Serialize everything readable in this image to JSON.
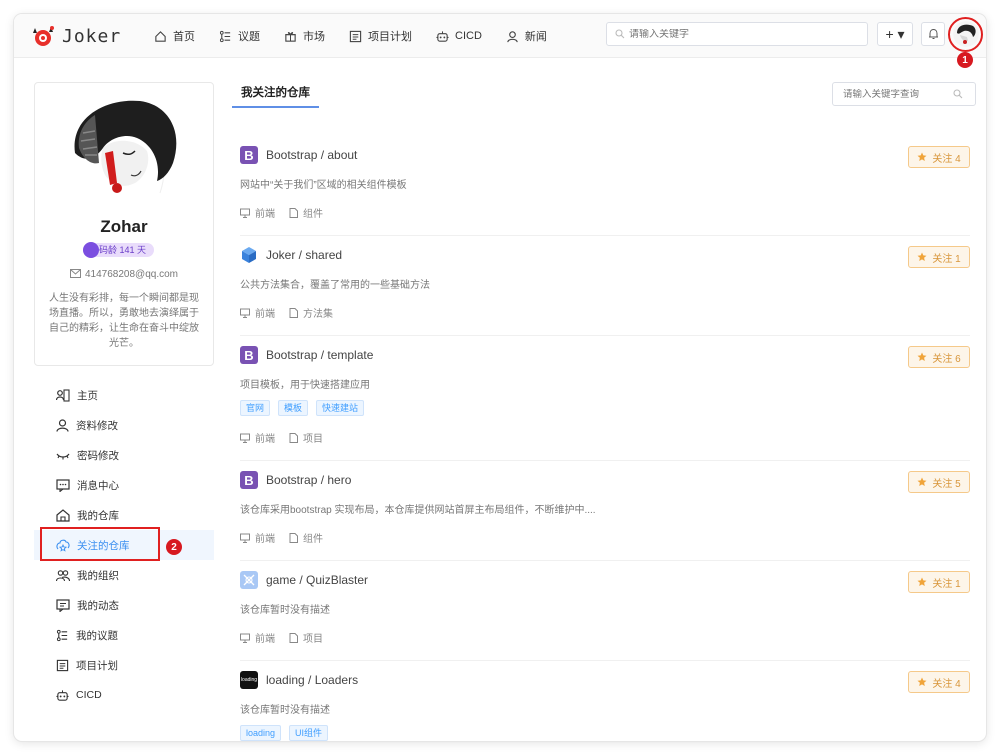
{
  "header": {
    "app_name": "Joker",
    "nav": [
      {
        "label": "首页",
        "icon": "home-icon"
      },
      {
        "label": "议题",
        "icon": "issue-icon"
      },
      {
        "label": "市场",
        "icon": "gift-icon"
      },
      {
        "label": "项目计划",
        "icon": "plan-icon"
      },
      {
        "label": "CICD",
        "icon": "robot-icon"
      },
      {
        "label": "新闻",
        "icon": "user-news-icon"
      }
    ],
    "search_placeholder": "请输入关键字",
    "plus_label": "+ ▾"
  },
  "annotations": {
    "marker1": "1",
    "marker2": "2"
  },
  "profile": {
    "name": "Zohar",
    "age_badge": "码龄 141 天",
    "email": "414768208@qq.com",
    "bio": "人生没有彩排，每一个瞬间都是现场直播。所以，勇敢地去演绎属于自己的精彩，让生命在奋斗中绽放光芒。"
  },
  "menu": [
    {
      "label": "主页",
      "icon": "home-card-icon",
      "active": false
    },
    {
      "label": "资料修改",
      "icon": "user-icon",
      "active": false
    },
    {
      "label": "密码修改",
      "icon": "eye-closed-icon",
      "active": false
    },
    {
      "label": "消息中心",
      "icon": "message-icon",
      "active": false
    },
    {
      "label": "我的仓库",
      "icon": "repo-house-icon",
      "active": false
    },
    {
      "label": "关注的仓库",
      "icon": "star-repo-icon",
      "active": true
    },
    {
      "label": "我的组织",
      "icon": "group-icon",
      "active": false
    },
    {
      "label": "我的动态",
      "icon": "activity-icon",
      "active": false
    },
    {
      "label": "我的议题",
      "icon": "issue-icon",
      "active": false
    },
    {
      "label": "项目计划",
      "icon": "plan-icon",
      "active": false
    },
    {
      "label": "CICD",
      "icon": "robot-icon",
      "active": false
    }
  ],
  "main": {
    "tab": "我关注的仓库",
    "search_placeholder": "请输入关键字查询",
    "repos": [
      {
        "title": "Bootstrap / about",
        "icon": "bootstrap",
        "desc": "网站中“关于我们”区域的相关组件模板",
        "tags": [],
        "category": "前端",
        "type": "组件",
        "star": "关注 4"
      },
      {
        "title": "Joker / shared",
        "icon": "cube",
        "desc": "公共方法集合，覆盖了常用的一些基础方法",
        "tags": [],
        "category": "前端",
        "type": "方法集",
        "star": "关注 1"
      },
      {
        "title": "Bootstrap / template",
        "icon": "bootstrap",
        "desc": "项目模板，用于快速搭建应用",
        "tags": [
          "官网",
          "模板",
          "快速建站"
        ],
        "category": "前端",
        "type": "项目",
        "star": "关注 6"
      },
      {
        "title": "Bootstrap / hero",
        "icon": "bootstrap",
        "desc": "该仓库采用bootstrap 实现布局，本仓库提供网站首屏主布局组件，不断维护中....",
        "tags": [],
        "category": "前端",
        "type": "组件",
        "star": "关注 5"
      },
      {
        "title": "game / QuizBlaster",
        "icon": "game",
        "desc": "该仓库暂时没有描述",
        "tags": [],
        "category": "前端",
        "type": "项目",
        "star": "关注 1"
      },
      {
        "title": "loading / Loaders",
        "icon": "loading",
        "desc": "该仓库暂时没有描述",
        "tags": [
          "loading",
          "UI组件"
        ],
        "category": "",
        "type": "",
        "star": "关注 4"
      }
    ]
  }
}
